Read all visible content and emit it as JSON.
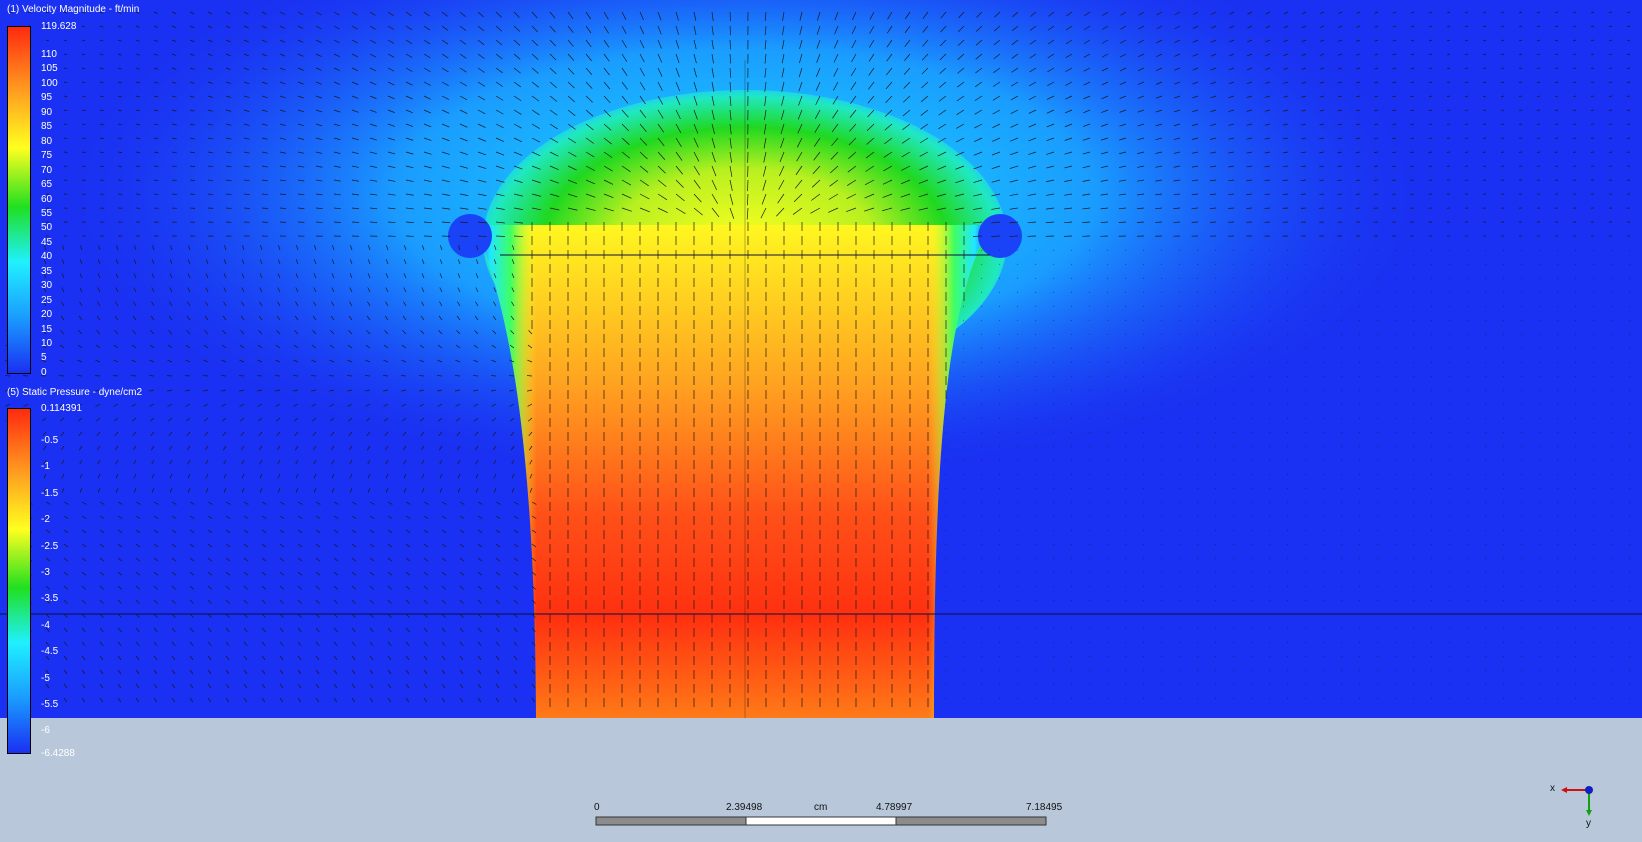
{
  "legends": [
    {
      "title": "(1) Velocity Magnitude - ft/min",
      "max_label": "119.628",
      "ticks": [
        "110",
        "105",
        "100",
        "95",
        "90",
        "85",
        "80",
        "75",
        "70",
        "65",
        "60",
        "55",
        "50",
        "45",
        "40",
        "35",
        "30",
        "25",
        "20",
        "15",
        "10",
        "5",
        "0"
      ]
    },
    {
      "title": "(5) Static Pressure - dyne/cm2",
      "max_label": "0.114391",
      "ticks": [
        "-0.5",
        "-1",
        "-1.5",
        "-2",
        "-2.5",
        "-3",
        "-3.5",
        "-4",
        "-4.5",
        "-5",
        "-5.5",
        "-6"
      ],
      "min_label": "-6.4288"
    }
  ],
  "scale_bar": {
    "labels": [
      "0",
      "2.39498",
      "4.78997",
      "7.18495"
    ],
    "unit": "cm"
  },
  "triad": {
    "x_label": "x",
    "y_label": "y"
  },
  "colors": {
    "field_low": "#1a30f2",
    "background": "#b8c8da",
    "jet_high": "#ff2a10"
  }
}
